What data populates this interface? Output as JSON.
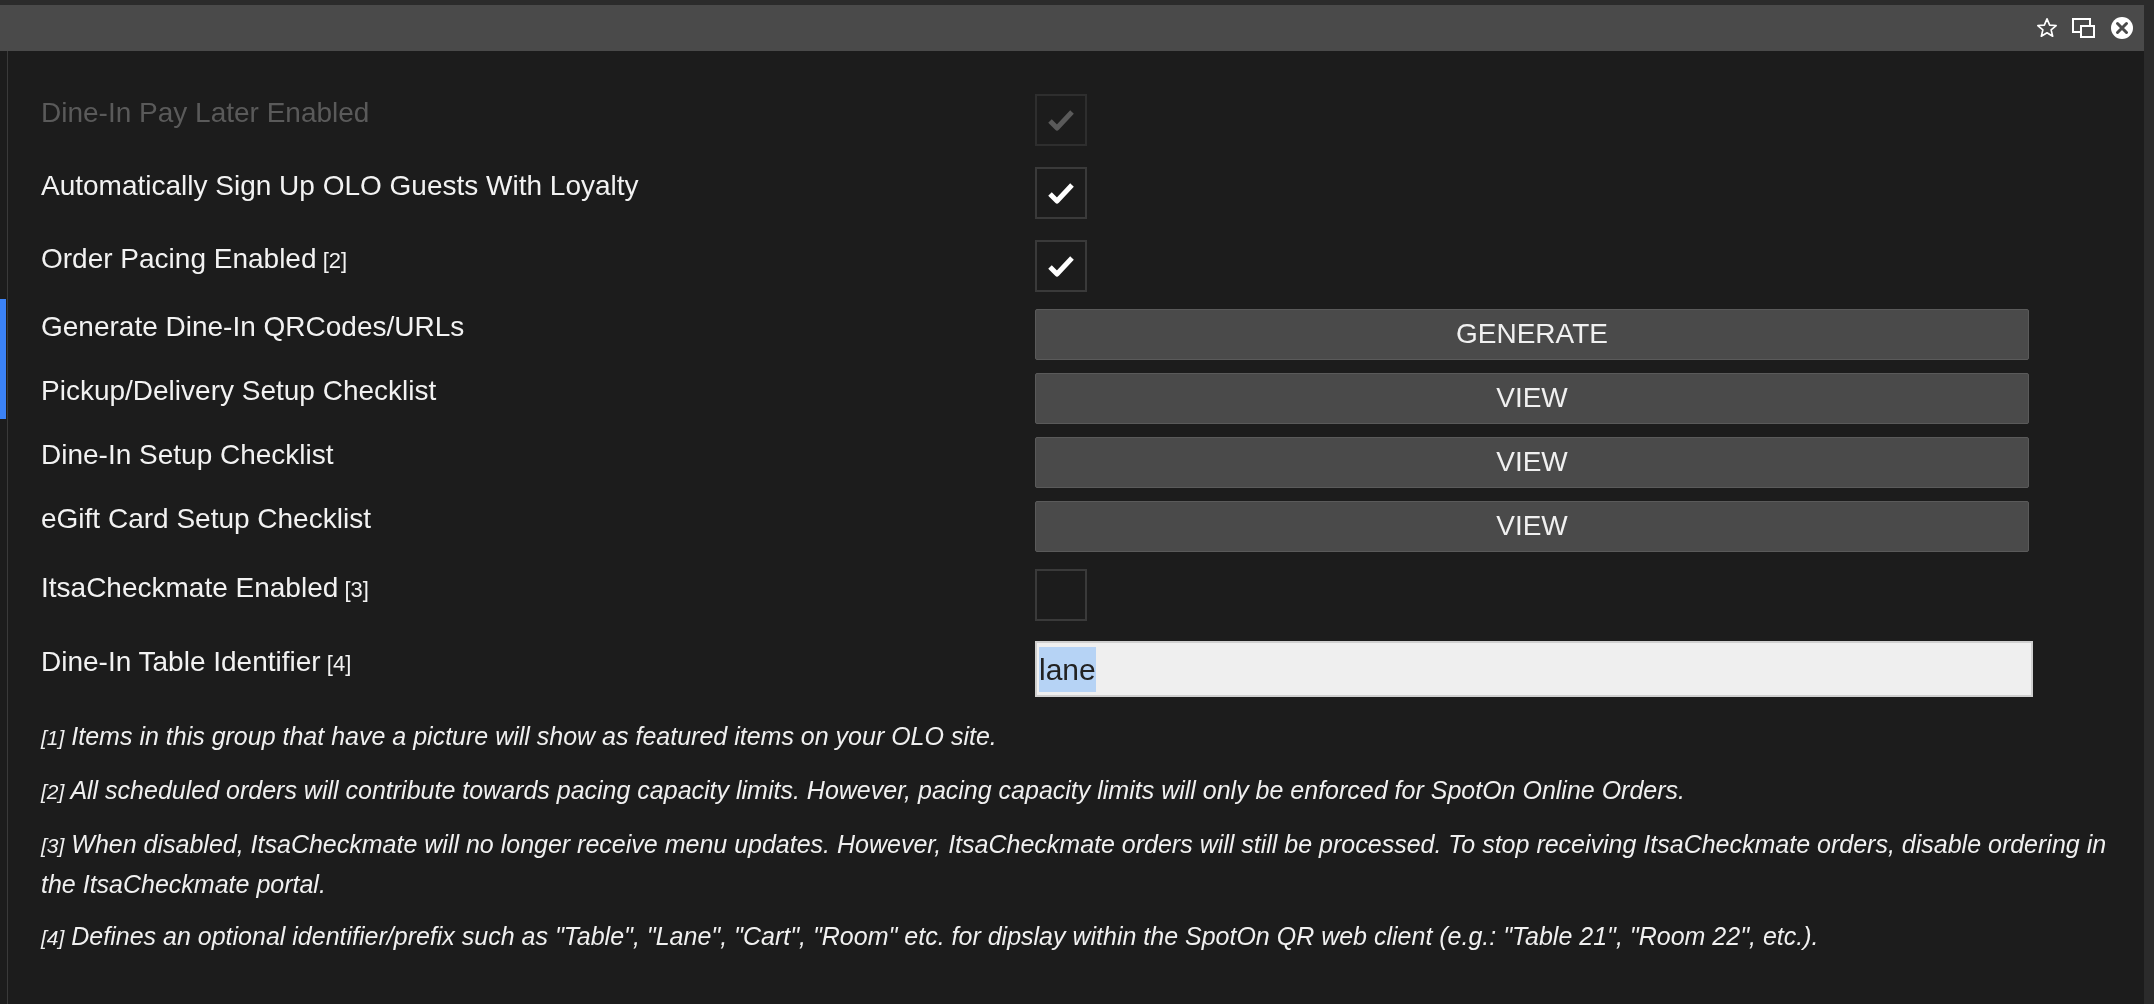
{
  "settings": [
    {
      "kind": "checkbox",
      "label": "Dine-In Pay Later Enabled",
      "checked": true,
      "disabled": true
    },
    {
      "kind": "checkbox",
      "label": "Automatically Sign Up OLO Guests With Loyalty",
      "checked": true,
      "disabled": false
    },
    {
      "kind": "checkbox",
      "label": "Order Pacing Enabled",
      "note": "[2]",
      "checked": true,
      "disabled": false
    },
    {
      "kind": "button",
      "label": "Generate Dine-In QRCodes/URLs",
      "button": "GENERATE"
    },
    {
      "kind": "button",
      "label": "Pickup/Delivery Setup Checklist",
      "button": "VIEW"
    },
    {
      "kind": "button",
      "label": "Dine-In Setup Checklist",
      "button": "VIEW"
    },
    {
      "kind": "button",
      "label": "eGift Card Setup Checklist",
      "button": "VIEW"
    },
    {
      "kind": "checkbox",
      "label": "ItsaCheckmate Enabled",
      "note": "[3]",
      "checked": false,
      "disabled": false
    },
    {
      "kind": "input",
      "label": "Dine-In Table Identifier",
      "note": "[4]",
      "value": "lane",
      "text_selected": true
    }
  ],
  "footnotes": [
    {
      "marker": "[1]",
      "text": "Items in this group that have a picture will show as featured items on your OLO site."
    },
    {
      "marker": "[2]",
      "text": "All scheduled orders will contribute towards pacing capacity limits. However, pacing capacity limits will only be enforced for SpotOn Online Orders."
    },
    {
      "marker": "[3]",
      "text": "When disabled, ItsaCheckmate will no longer receive menu updates. However, ItsaCheckmate orders will still be processed. To stop receiving ItsaCheckmate orders, disable ordering in the ItsaCheckmate portal."
    },
    {
      "marker": "[4]",
      "text": "Defines an optional identifier/prefix such as \"Table\", \"Lane\", \"Cart\", \"Room\" etc. for dipslay within the SpotOn QR web client (e.g.: \"Table 21\", \"Room 22\", etc.)."
    }
  ]
}
